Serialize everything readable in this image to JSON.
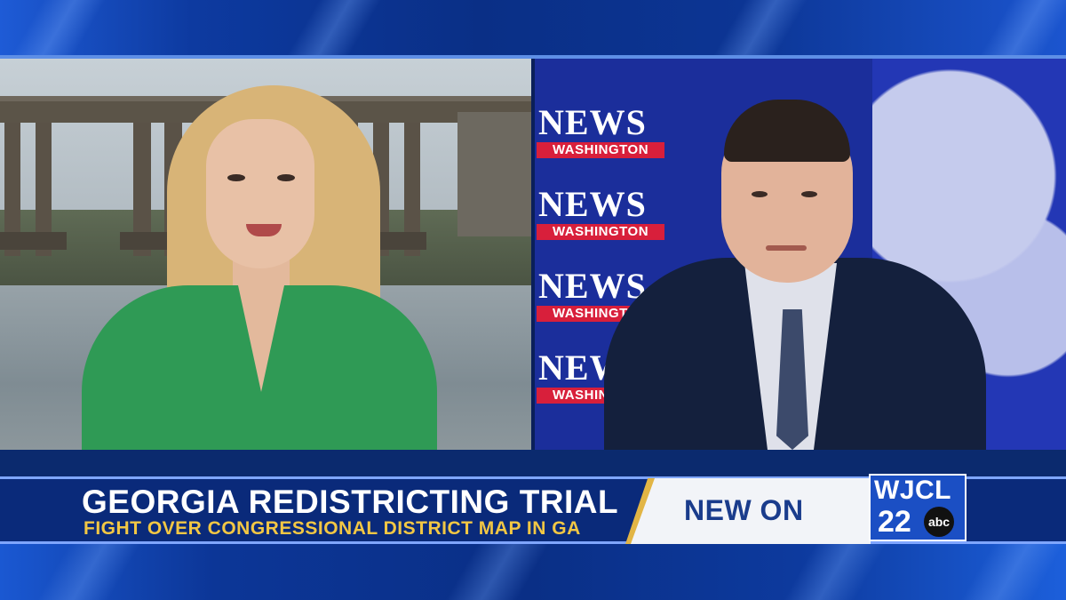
{
  "lower_third": {
    "headline": "GEORGIA REDISTRICTING TRIAL",
    "subheadline": "FIGHT OVER CONGRESSIONAL DISTRICT MAP IN GA",
    "promo": "NEW ON"
  },
  "station": {
    "call_letters": "WJCL",
    "channel": "22",
    "network": "abc"
  },
  "backdrop_logo": {
    "news": "NEWS",
    "washington": "WASHINGTON"
  },
  "colors": {
    "frame_blue": "#0a2f86",
    "accent_gold": "#e2b545",
    "subheadline_gold": "#f2c744",
    "logo_red": "#d81f3b"
  }
}
